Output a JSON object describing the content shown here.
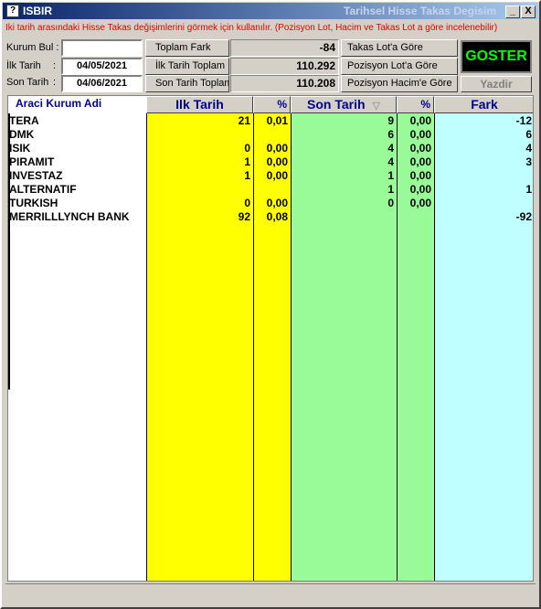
{
  "window": {
    "title_left": "ISBIR",
    "title_right": "Tarihsel Hisse Takas Degisim",
    "minimize": "_",
    "close": "X",
    "icon": "app-icon"
  },
  "info_text": "İki tarih arasındaki Hisse Takas değişimlerini görmek için kullanılır. (Pozisyon Lot, Hacim ve Takas Lot a göre incelenebilir)",
  "form": {
    "kurum_bul_label": "Kurum Bul :",
    "kurum_bul_value": "",
    "ilk_tarih_label": "İlk Tarih",
    "ilk_tarih_colon": ":",
    "ilk_tarih_value": "04/05/2021",
    "son_tarih_label": "Son Tarih",
    "son_tarih_colon": ":",
    "son_tarih_value": "04/06/2021"
  },
  "summary": {
    "toplam_fark_label": "Toplam Fark",
    "toplam_fark_value": "-84",
    "ilk_tarih_toplam_label": "İlk Tarih Toplam",
    "ilk_tarih_toplam_value": "110.292",
    "son_tarih_toplam_label": "Son Tarih Toplam",
    "son_tarih_toplam_value": "110.208"
  },
  "modes": {
    "takas_lot": "Takas Lot'a Göre",
    "pozisyon_lot": "Pozisyon Lot'a Göre",
    "pozisyon_hacim": "Pozisyon Hacim'e Göre"
  },
  "actions": {
    "goster": "GOSTER",
    "yazdir": "Yazdir"
  },
  "colors": {
    "yellow_cols": "#ffff00",
    "green_cols": "#98fb98",
    "cyan_col": "#c0ffff",
    "goster_text": "#00ff00",
    "info_text": "#e00000"
  },
  "table": {
    "headers": {
      "kurum": "Araci Kurum Adi",
      "ilk_tarih": "Ilk Tarih",
      "ilk_pct": "%",
      "son_tarih": "Son Tarih",
      "sort_icon": "▽",
      "son_pct": "%",
      "fark": "Fark"
    },
    "rows": [
      {
        "kurum": "TERA",
        "ilk": "21",
        "ilk_pct": "0,01",
        "son": "9",
        "son_pct": "0,00",
        "fark": "-12"
      },
      {
        "kurum": "DMK",
        "ilk": "",
        "ilk_pct": "",
        "son": "6",
        "son_pct": "0,00",
        "fark": "6"
      },
      {
        "kurum": "ISIK",
        "ilk": "0",
        "ilk_pct": "0,00",
        "son": "4",
        "son_pct": "0,00",
        "fark": "4"
      },
      {
        "kurum": "PIRAMIT",
        "ilk": "1",
        "ilk_pct": "0,00",
        "son": "4",
        "son_pct": "0,00",
        "fark": "3"
      },
      {
        "kurum": "INVESTAZ",
        "ilk": "1",
        "ilk_pct": "0,00",
        "son": "1",
        "son_pct": "0,00",
        "fark": ""
      },
      {
        "kurum": "ALTERNATIF",
        "ilk": "",
        "ilk_pct": "",
        "son": "1",
        "son_pct": "0,00",
        "fark": "1"
      },
      {
        "kurum": "TURKISH",
        "ilk": "0",
        "ilk_pct": "0,00",
        "son": "0",
        "son_pct": "0,00",
        "fark": ""
      },
      {
        "kurum": "MERRILLLYNCH BANK",
        "ilk": "92",
        "ilk_pct": "0,08",
        "son": "",
        "son_pct": "",
        "fark": "-92"
      }
    ]
  }
}
